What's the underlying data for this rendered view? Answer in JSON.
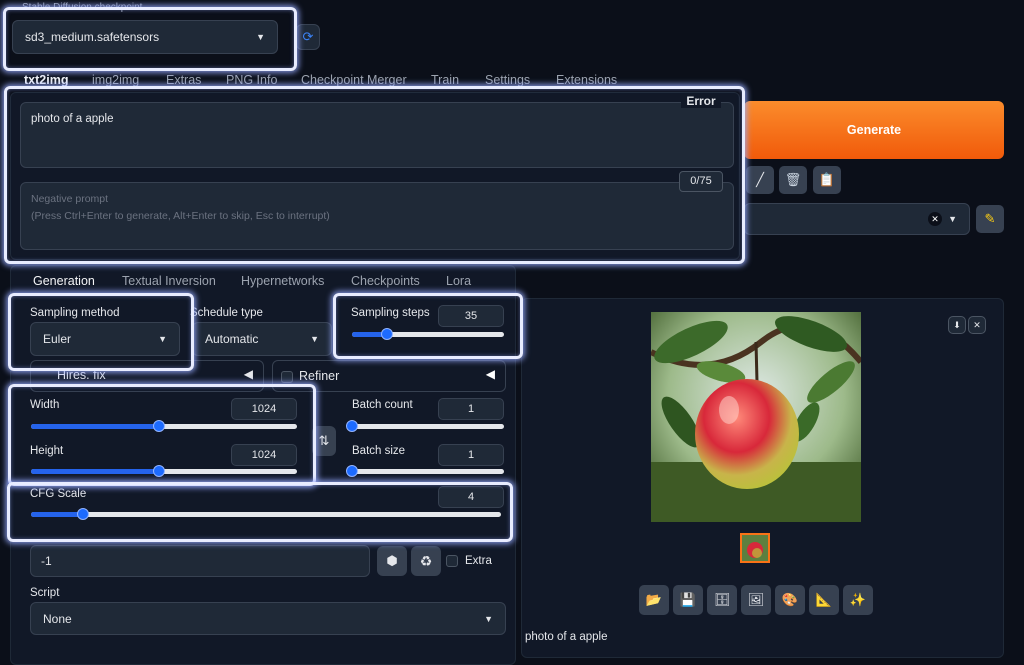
{
  "checkpoint": {
    "label": "Stable Diffusion checkpoint",
    "value": "sd3_medium.safetensors"
  },
  "top_tabs": [
    "txt2img",
    "img2img",
    "Extras",
    "PNG Info",
    "Checkpoint Merger",
    "Train",
    "Settings",
    "Extensions"
  ],
  "prompt": {
    "value": "photo of a apple",
    "error_badge": "Error",
    "token_counter": "0/75"
  },
  "negative_prompt": {
    "placeholder": "Negative prompt",
    "hint": "(Press Ctrl+Enter to generate, Alt+Enter to skip, Esc to interrupt)"
  },
  "generate_label": "Generate",
  "sub_tabs": [
    "Generation",
    "Textual Inversion",
    "Hypernetworks",
    "Checkpoints",
    "Lora"
  ],
  "sampling_method": {
    "label": "Sampling method",
    "value": "Euler"
  },
  "schedule_type": {
    "label": "Schedule type",
    "value": "Automatic"
  },
  "sampling_steps": {
    "label": "Sampling steps",
    "value": "35",
    "fraction": 0.23
  },
  "hires_fix": "Hires. fix",
  "refiner": "Refiner",
  "width": {
    "label": "Width",
    "value": "1024",
    "fraction": 0.48
  },
  "height": {
    "label": "Height",
    "value": "1024",
    "fraction": 0.48
  },
  "batch_count": {
    "label": "Batch count",
    "value": "1",
    "fraction": 0.0
  },
  "batch_size": {
    "label": "Batch size",
    "value": "1",
    "fraction": 0.0
  },
  "cfg_scale": {
    "label": "CFG Scale",
    "value": "4",
    "fraction": 0.11
  },
  "seed": {
    "value": "-1",
    "extra_label": "Extra"
  },
  "script": {
    "label": "Script",
    "value": "None"
  },
  "output": {
    "caption": "photo of a apple"
  },
  "colors": {
    "accent": "#f97316",
    "slider": "#2563eb",
    "highlight": "#e8ecff"
  }
}
